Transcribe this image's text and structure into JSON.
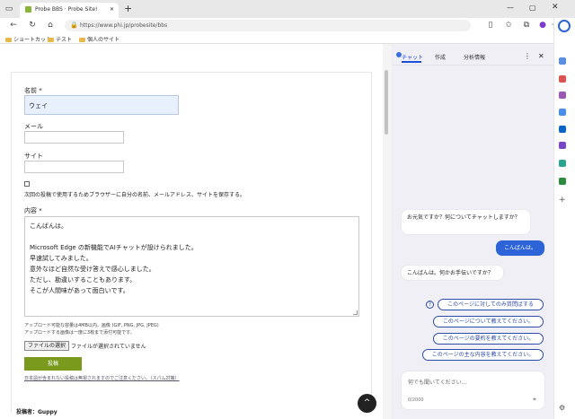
{
  "browser": {
    "tab_title": "Probe BBS · Probe Site!",
    "tab_close": "✕",
    "new_tab": "+",
    "url": "https://www.phi.jp/probesite/bbs",
    "favorites": [
      "ショートカット",
      "テスト",
      "個人のサイト"
    ]
  },
  "form": {
    "name_label": "名前 *",
    "name_value": "ウェイ",
    "mail_label": "メール",
    "site_label": "サイト",
    "save_consent": "次回の投稿で使用するためブラウザーに自分の名前、メールアドレス、サイトを保存する。",
    "content_label": "内容 *",
    "content_lines": [
      "こんばんは。",
      "",
      "Microsoft Edge の新機能でAIチャットが設けられました。",
      "早速試してみました。",
      "意外なほど自然な受け答えで感心しました。",
      "ただし、勘違いすることもあります。",
      "そこが人間味があって面白いです。"
    ],
    "upload_note_1": "アップロード可能な容量は4MB以内。画像 (GIF, PNG, JPG, JPEG)",
    "upload_note_2": "アップロードする画像は一度に3枚まで添付可能です。",
    "file_button": "ファイルの選択",
    "file_status": "ファイルが選択されていません",
    "submit_button": "投稿",
    "spam_note": "日本語が含まれない投稿は無視されますのでご注意ください。（スパム対策）",
    "poster": "投稿者：Guppy"
  },
  "copilot": {
    "tabs": [
      "チャット",
      "作成",
      "分析情報"
    ],
    "messages": [
      {
        "role": "bot",
        "text": "お元気ですか？何についてチャットしますか？"
      },
      {
        "role": "user",
        "text": "こんばんは。"
      },
      {
        "role": "bot",
        "text": "こんばんは。何かお手伝いですか？"
      }
    ],
    "suggestions": [
      "このページに対してのみ質問ばする",
      "このページについて教えてください。",
      "このページの要約を教えてください。",
      "このページの主な内容を教えてください。"
    ],
    "input_placeholder": "何でも聞いてください...",
    "char_count": "0/2000"
  },
  "colors": {
    "accent": "#2c63d6",
    "submit": "#7a9a1e"
  }
}
